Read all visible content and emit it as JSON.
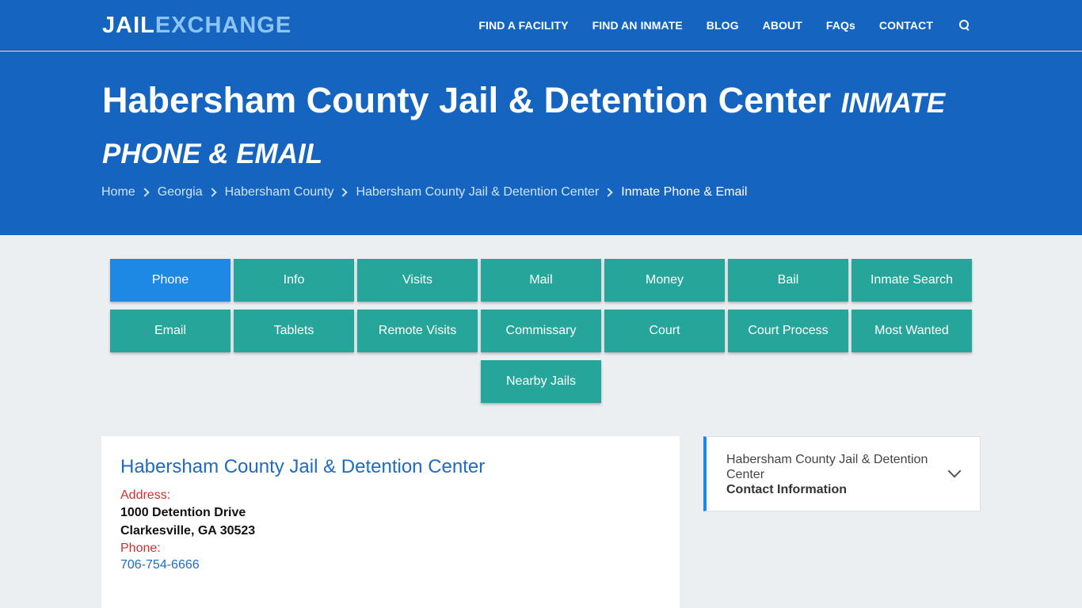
{
  "header": {
    "logo_part1": "JAIL",
    "logo_part2": "EXCHANGE",
    "nav": [
      "FIND A FACILITY",
      "FIND AN INMATE",
      "BLOG",
      "ABOUT",
      "FAQs",
      "CONTACT"
    ]
  },
  "hero": {
    "title": "Habersham County Jail & Detention Center",
    "subtitle": "INMATE PHONE & EMAIL",
    "breadcrumbs": [
      "Home",
      "Georgia",
      "Habersham County",
      "Habersham County Jail & Detention Center"
    ],
    "breadcrumb_current": "Inmate Phone & Email"
  },
  "buttons": [
    "Phone",
    "Info",
    "Visits",
    "Mail",
    "Money",
    "Bail",
    "Inmate Search",
    "Email",
    "Tablets",
    "Remote Visits",
    "Commissary",
    "Court",
    "Court Process",
    "Most Wanted",
    "Nearby Jails"
  ],
  "active_button": "Phone",
  "card": {
    "title": "Habersham County Jail & Detention Center",
    "address_label": "Address:",
    "address_line1": "1000 Detention Drive",
    "address_line2": "Clarkesville, GA 30523",
    "phone_label": "Phone:",
    "phone": "706-754-6666"
  },
  "side": {
    "facility": "Habersham County Jail & Detention Center",
    "section": "Contact Information"
  },
  "colors": {
    "primary_blue": "#1565c0",
    "teal": "#26a69a",
    "active_blue": "#1e88e5",
    "label_red": "#d32f2f"
  }
}
